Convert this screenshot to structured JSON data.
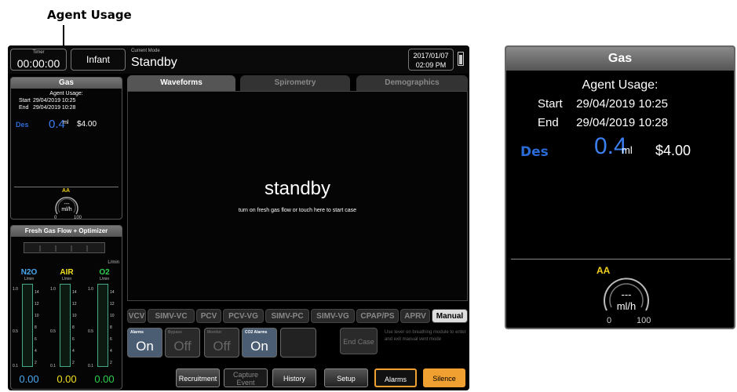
{
  "caption": "Agent Usage",
  "topbar": {
    "timer_label": "Timer",
    "timer_value": "00:00:00",
    "patient_type": "Infant",
    "mode_label": "Current Mode",
    "mode_value": "Standby",
    "date": "2017/01/07",
    "time": "02:09 PM"
  },
  "gas_panel": {
    "title": "Gas",
    "agent_usage_label": "Agent Usage:",
    "start_label": "Start",
    "start_value": "29/04/2019 10:25",
    "end_label": "End",
    "end_value": "29/04/2019 10:28",
    "agent": "Des",
    "volume": "0.4",
    "volume_unit": "ml",
    "cost": "$4.00",
    "aa_label": "AA",
    "gauge_value": "---",
    "gauge_unit": "ml/h",
    "gauge_min": "0",
    "gauge_max": "100"
  },
  "fresh_gas": {
    "title": "Fresh Gas Flow + Optimizer",
    "unit": "L/min",
    "flows": [
      {
        "name": "N2O",
        "unit": "L/min",
        "value": "0.00",
        "color": "#4aa8f0"
      },
      {
        "name": "AIR",
        "unit": "L/min",
        "value": "0.00",
        "color": "#f0e020"
      },
      {
        "name": "O2",
        "unit": "L/min",
        "value": "0.00",
        "color": "#30d050"
      }
    ],
    "scale_left": [
      "1.0",
      "0.5",
      "0.1"
    ],
    "scale_tube": [
      "14",
      "12",
      "10",
      "8",
      "6",
      "4",
      "2"
    ]
  },
  "tabs": [
    "Waveforms",
    "Spirometry",
    "Demographics"
  ],
  "waveform": {
    "status": "standby",
    "instruction": "turn on fresh gas flow or touch here to start case"
  },
  "modes": [
    "VCV",
    "SIMV-VC",
    "PCV",
    "PCV-VG",
    "SIMV-PC",
    "SIMV-VG",
    "CPAP/PS",
    "APRV",
    "Manual"
  ],
  "controls": [
    {
      "label": "Alarms",
      "value": "On"
    },
    {
      "label": "Bypass",
      "value": "Off"
    },
    {
      "label": "Monitor",
      "value": "Off"
    },
    {
      "label": "CO2 Alarms",
      "value": "On"
    }
  ],
  "end_case": "End Case",
  "end_case_note": "Use lever on breathing module to enter and exit manual vent mode",
  "bottom_buttons": {
    "recruitment": "Recruitment",
    "capture_line1": "Capture",
    "capture_line2": "Event",
    "history": "History",
    "setup": "Setup",
    "alarms": "Alarms",
    "silence": "Silence"
  },
  "colors": {
    "accent_blue": "#3a7ef0",
    "aa_yellow": "#f0d020",
    "alarm_orange": "#f0a030"
  }
}
